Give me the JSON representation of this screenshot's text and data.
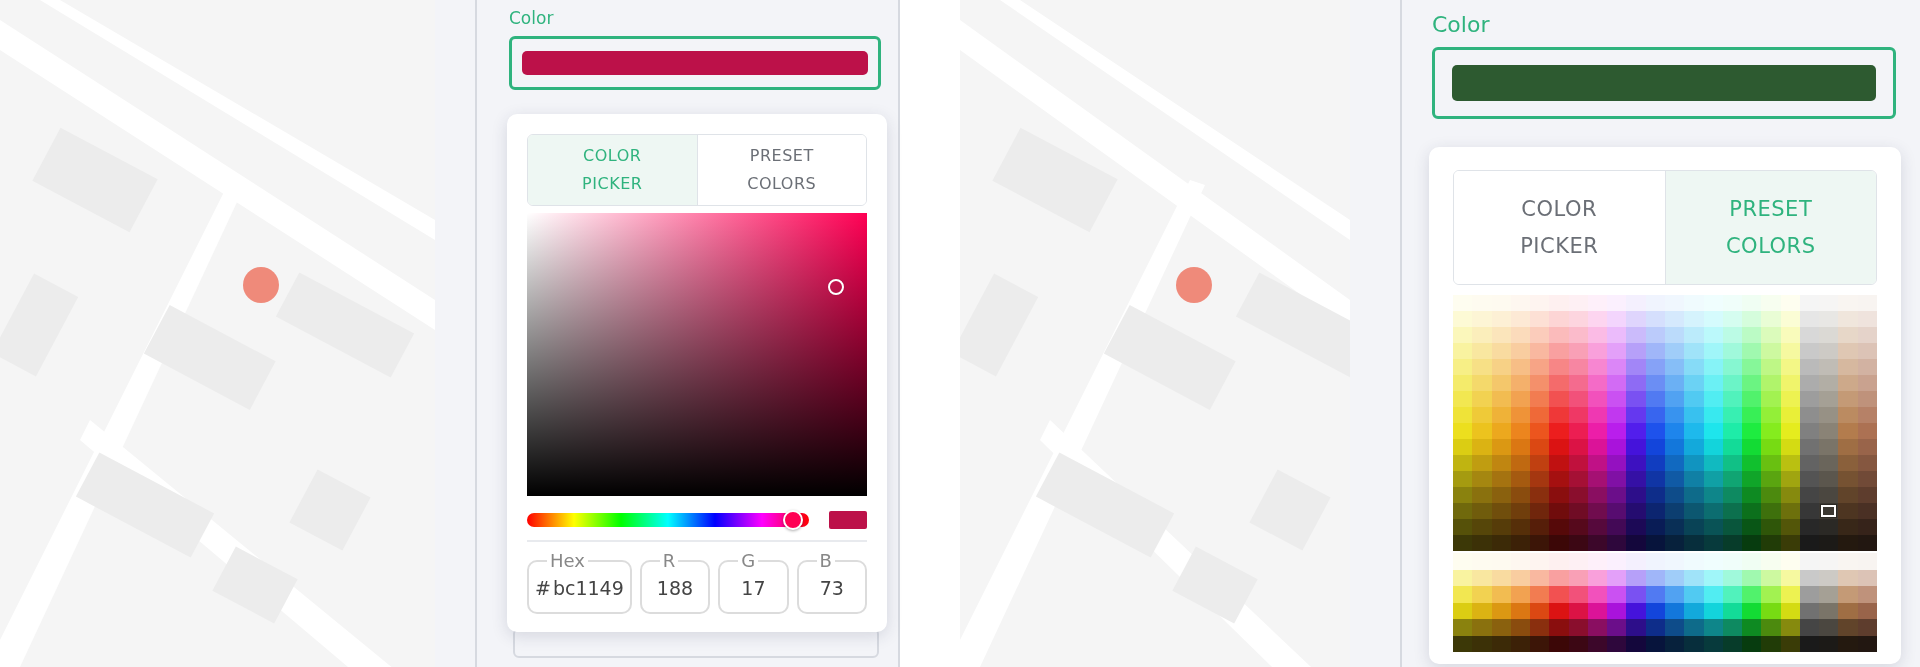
{
  "views": [
    {
      "kind": "picker",
      "field": {
        "label": "Color",
        "color": "#bc1149"
      },
      "tabs": [
        {
          "label": "COLOR PICKER",
          "selected": true
        },
        {
          "label": "PRESET COLORS",
          "selected": false
        }
      ],
      "hue": {
        "level": 0.945
      },
      "inputs": [
        {
          "label": "Hex",
          "prefix": "#",
          "value": "bc1149"
        },
        {
          "label": "R",
          "value": "188"
        },
        {
          "label": "G",
          "value": "17"
        },
        {
          "label": "B",
          "value": "73"
        }
      ]
    },
    {
      "kind": "presets",
      "field": {
        "label": "Color",
        "color": "#2d5a30"
      },
      "tabs": [
        {
          "label": "COLOR PICKER",
          "selected": false
        },
        {
          "label": "PRESET COLORS",
          "selected": true
        }
      ]
    }
  ]
}
